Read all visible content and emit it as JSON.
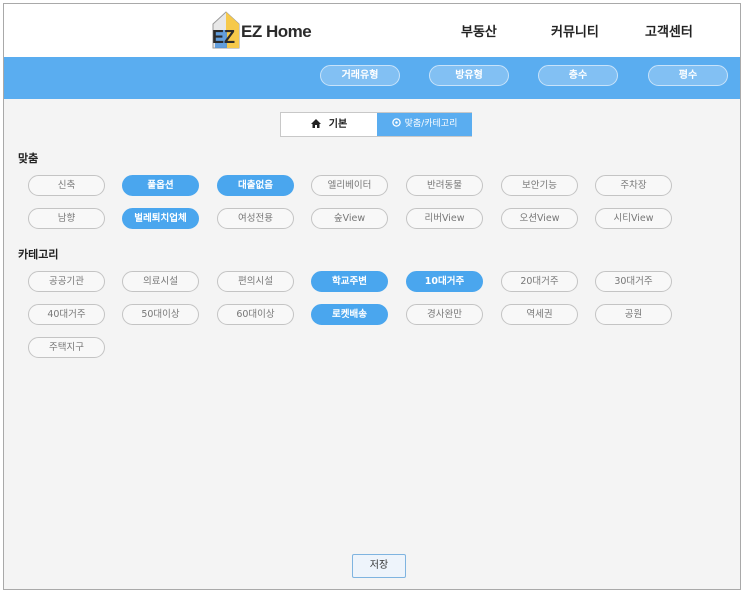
{
  "header": {
    "logo_text": "EZ Home",
    "nav": [
      "부동산",
      "커뮤니티",
      "고객센터"
    ]
  },
  "filter_bar": {
    "pills": [
      "거래유형",
      "방유형",
      "층수",
      "평수"
    ]
  },
  "segmented": {
    "basic_label": "기본",
    "custom_label": "맞춤/카테고리",
    "basic_icon": "home-icon",
    "custom_icon": "target-icon"
  },
  "sections": [
    {
      "title": "맞춤",
      "chips": [
        {
          "label": "신축",
          "active": false
        },
        {
          "label": "풀옵션",
          "active": true
        },
        {
          "label": "대출없음",
          "active": true
        },
        {
          "label": "엘리베이터",
          "active": false
        },
        {
          "label": "반려동물",
          "active": false
        },
        {
          "label": "보안기능",
          "active": false
        },
        {
          "label": "주차장",
          "active": false
        },
        {
          "label": "남향",
          "active": false
        },
        {
          "label": "벌레퇴치업체",
          "active": true
        },
        {
          "label": "여성전용",
          "active": false
        },
        {
          "label": "숲View",
          "active": false
        },
        {
          "label": "리버View",
          "active": false
        },
        {
          "label": "오션View",
          "active": false
        },
        {
          "label": "시티View",
          "active": false
        }
      ]
    },
    {
      "title": "카테고리",
      "chips": [
        {
          "label": "공공기관",
          "active": false
        },
        {
          "label": "의료시설",
          "active": false
        },
        {
          "label": "편의시설",
          "active": false
        },
        {
          "label": "학교주변",
          "active": true
        },
        {
          "label": "10대거주",
          "active": true
        },
        {
          "label": "20대거주",
          "active": false
        },
        {
          "label": "30대거주",
          "active": false
        },
        {
          "label": "40대거주",
          "active": false
        },
        {
          "label": "50대이상",
          "active": false
        },
        {
          "label": "60대이상",
          "active": false
        },
        {
          "label": "로켓배송",
          "active": true
        },
        {
          "label": "경사완만",
          "active": false
        },
        {
          "label": "역세권",
          "active": false
        },
        {
          "label": "공원",
          "active": false
        },
        {
          "label": "주택지구",
          "active": false
        }
      ]
    }
  ],
  "save_label": "저장",
  "colors": {
    "accent": "#4aa6ee",
    "bar": "#5aadf0",
    "logo_yellow": "#f6c94a",
    "logo_blue": "#4a90d9"
  }
}
